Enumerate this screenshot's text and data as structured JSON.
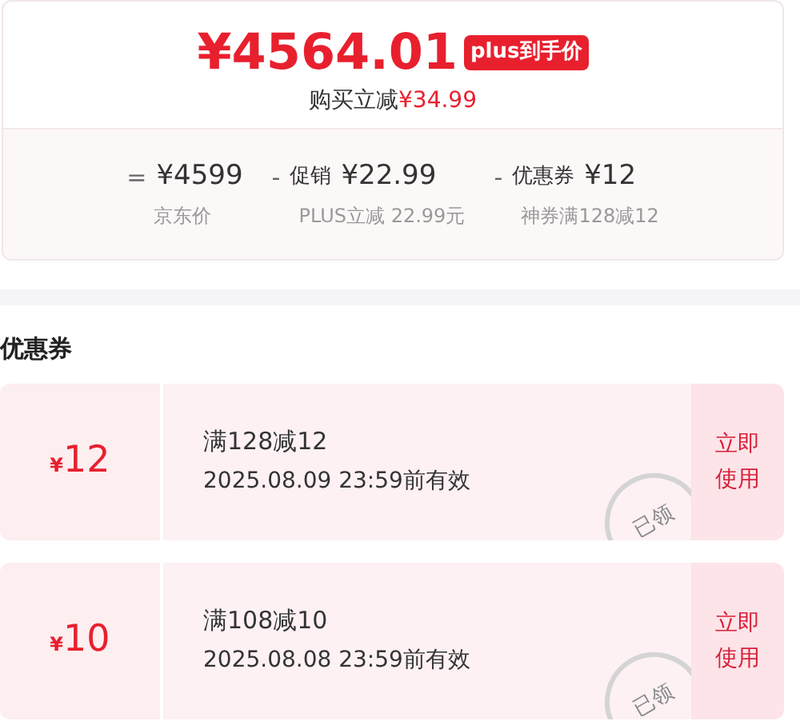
{
  "price": {
    "amount": "¥4564.01",
    "badge": "plus到手价",
    "saving_label": "购买立减",
    "saving_value": "¥34.99"
  },
  "breakdown": [
    {
      "operator": "=",
      "value": "¥4599",
      "note": "京东价"
    },
    {
      "operator": "-",
      "label": "促销",
      "value": "¥22.99",
      "note": "PLUS立减 22.99元"
    },
    {
      "operator": "-",
      "label": "优惠券",
      "value": "¥12",
      "note": "神券满128减12"
    }
  ],
  "coupons_title": "优惠券",
  "coupons": [
    {
      "currency": "¥",
      "amount": "12",
      "condition": "满128减12",
      "expiry": "2025.08.09 23:59前有效",
      "stamp": "已领",
      "action": "立即使用"
    },
    {
      "currency": "¥",
      "amount": "10",
      "condition": "满108减10",
      "expiry": "2025.08.08 23:59前有效",
      "stamp": "已领",
      "action": "立即使用"
    }
  ]
}
